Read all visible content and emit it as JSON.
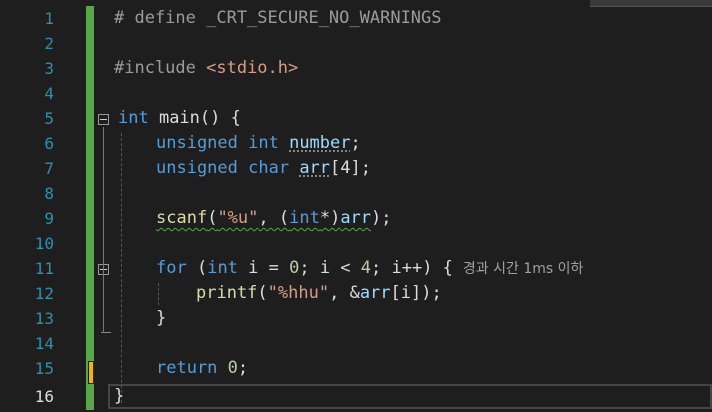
{
  "lines": [
    {
      "num": "1"
    },
    {
      "num": "2"
    },
    {
      "num": "3"
    },
    {
      "num": "4"
    },
    {
      "num": "5"
    },
    {
      "num": "6"
    },
    {
      "num": "7"
    },
    {
      "num": "8"
    },
    {
      "num": "9"
    },
    {
      "num": "10"
    },
    {
      "num": "11"
    },
    {
      "num": "12"
    },
    {
      "num": "13"
    },
    {
      "num": "14"
    },
    {
      "num": "15"
    },
    {
      "num": "16"
    }
  ],
  "code": {
    "l1": "# define _CRT_SECURE_NO_WARNINGS",
    "l3_include": "#include ",
    "l3_header": "<stdio.h>",
    "l5_kw": "int",
    "l5_rest": " main() {",
    "l6_kw": "unsigned int",
    "l6_var": "number",
    "l6_end": ";",
    "l7_kw": "unsigned char",
    "l7_var": "arr",
    "l7_idx": "[4]",
    "l7_end": ";",
    "l9_fn": "scanf",
    "l9_open": "(",
    "l9_str": "\"%u\"",
    "l9_mid": ", (",
    "l9_kw": "int",
    "l9_cast": "*)",
    "l9_var": "arr",
    "l9_end": ");",
    "l11_kw": "for",
    "l11_a": " (",
    "l11_int": "int",
    "l11_b": " i = ",
    "l11_n0": "0",
    "l11_c": "; i < ",
    "l11_n4": "4",
    "l11_d": "; i++) {",
    "l11_hint": "경과 시간 1ms 이하",
    "l12_fn": "printf",
    "l12_open": "(",
    "l12_str": "\"%hhu\"",
    "l12_mid": ", &",
    "l12_var": "arr",
    "l12_end": "[i]);",
    "l13": "}",
    "l15_kw": "return",
    "l15_sp": " ",
    "l15_num": "0",
    "l15_end": ";",
    "l16": "}"
  },
  "colors": {
    "keyword": "#569cd6",
    "string": "#d69d85",
    "function": "#dcdcaa",
    "variable": "#9cdcfe",
    "line_number": "#2b91af",
    "change_marker": "#57a64a",
    "unsaved_marker": "#efb700"
  }
}
